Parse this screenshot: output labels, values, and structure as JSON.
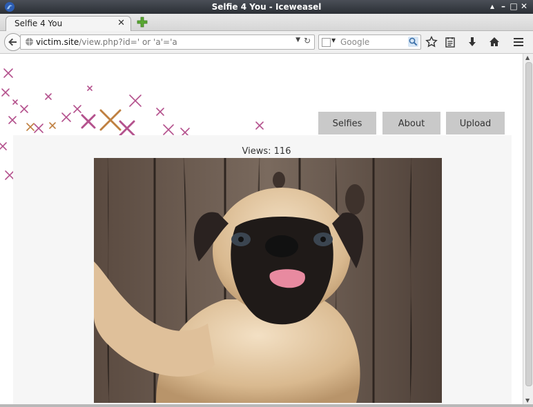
{
  "window": {
    "title": "Selfie 4 You - Iceweasel"
  },
  "tabs": [
    {
      "label": "Selfie 4 You"
    }
  ],
  "address_bar": {
    "host": "victim.site",
    "path": "/view.php?id=' or 'a'='a"
  },
  "search_bar": {
    "placeholder": "Google"
  },
  "site": {
    "nav": [
      {
        "label": "Selfies"
      },
      {
        "label": "About"
      },
      {
        "label": "Upload"
      }
    ],
    "views_label": "Views:",
    "views_count": "116"
  },
  "colors": {
    "deco_mark": "#a8347a",
    "deco_mark_alt": "#b56a20"
  },
  "icons": [
    "app-icon",
    "close-tab-icon",
    "new-tab-icon",
    "back-arrow-icon",
    "globe-icon",
    "dropdown-arrow-icon",
    "reload-icon",
    "search-engine-icon",
    "magnifier-icon",
    "bookmark-star-icon",
    "reading-list-icon",
    "download-arrow-icon",
    "home-icon",
    "hamburger-menu-icon",
    "pug-selfie-image"
  ]
}
